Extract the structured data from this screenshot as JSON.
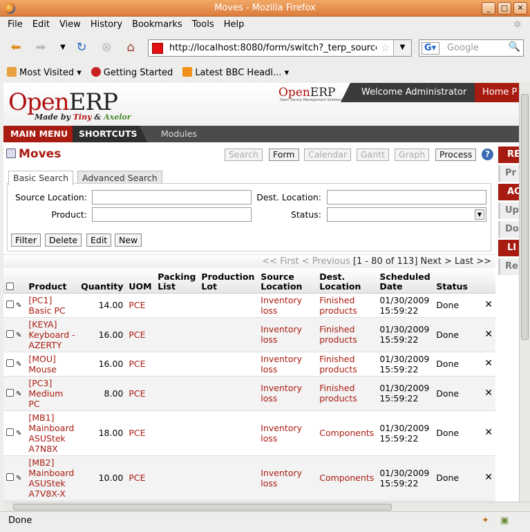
{
  "window": {
    "title": "Moves - Mozilla Firefox"
  },
  "menu": [
    "File",
    "Edit",
    "View",
    "History",
    "Bookmarks",
    "Tools",
    "Help"
  ],
  "nav": {
    "url": "http://localhost:8080/form/switch?_terp_source_",
    "search_placeholder": "Google"
  },
  "bookmarks": [
    "Most Visited",
    "Getting Started",
    "Latest BBC Headl..."
  ],
  "erp": {
    "logo_a": "Open",
    "logo_b": "ERP",
    "logo_sub_a": "Made by ",
    "logo_sub_tiny": "Tiny",
    "logo_sub_and": " & ",
    "logo_sub_axelor": "Axelor",
    "small_logo_a": "Open",
    "small_logo_b": "ERP",
    "small_logo_sub": "Open Source Management Solutions",
    "welcome": "Welcome Administrator",
    "home": "Home P",
    "mainmenu": "MAIN MENU",
    "shortcuts": "SHORTCUTS",
    "modules": "Modules",
    "page_title": "Moves",
    "views": [
      "Search",
      "Form",
      "Calendar",
      "Gantt",
      "Graph",
      "Process"
    ],
    "right_panel": [
      "RE",
      "Pr",
      "AC",
      "Up",
      "Do",
      "LI",
      "Re"
    ],
    "tabs": [
      "Basic Search",
      "Advanced Search"
    ],
    "labels": {
      "source": "Source Location:",
      "dest": "Dest. Location:",
      "product": "Product:",
      "status": "Status:"
    },
    "actions": [
      "Filter",
      "Delete",
      "Edit",
      "New"
    ],
    "pager": {
      "prev": "<< First < Previous",
      "range": "[1 - 80 of 113]",
      "next": "Next > Last >>"
    },
    "columns": [
      "Product",
      "Quantity",
      "UOM",
      "Packing List",
      "Production Lot",
      "Source Location",
      "Dest. Location",
      "Scheduled Date",
      "Status"
    ],
    "rows": [
      {
        "product": "[PC1] Basic PC",
        "qty": "14.00",
        "uom": "PCE",
        "src": "Inventory loss",
        "dest": "Finished products",
        "date": "01/30/2009 15:59:22",
        "status": "Done"
      },
      {
        "product": "[KEYA] Keyboard - AZERTY",
        "qty": "16.00",
        "uom": "PCE",
        "src": "Inventory loss",
        "dest": "Finished products",
        "date": "01/30/2009 15:59:22",
        "status": "Done"
      },
      {
        "product": "[MOU] Mouse",
        "qty": "16.00",
        "uom": "PCE",
        "src": "Inventory loss",
        "dest": "Finished products",
        "date": "01/30/2009 15:59:22",
        "status": "Done"
      },
      {
        "product": "[PC3] Medium PC",
        "qty": "8.00",
        "uom": "PCE",
        "src": "Inventory loss",
        "dest": "Finished products",
        "date": "01/30/2009 15:59:22",
        "status": "Done"
      },
      {
        "product": "[MB1] Mainboard ASUStek A7N8X",
        "qty": "18.00",
        "uom": "PCE",
        "src": "Inventory loss",
        "dest": "Components",
        "date": "01/30/2009 15:59:22",
        "status": "Done"
      },
      {
        "product": "[MB2] Mainboard ASUStek A7V8X-X",
        "qty": "10.00",
        "uom": "PCE",
        "src": "Inventory loss",
        "dest": "Components",
        "date": "01/30/2009 15:59:22",
        "status": "Done"
      }
    ]
  },
  "status_text": "Done",
  "icons": {
    "close": "close-icon",
    "edit": "pencil-icon",
    "delete": "delete-icon"
  },
  "colors": {
    "brand_red": "#a81b10",
    "titlebar": "#dc7c3c"
  }
}
